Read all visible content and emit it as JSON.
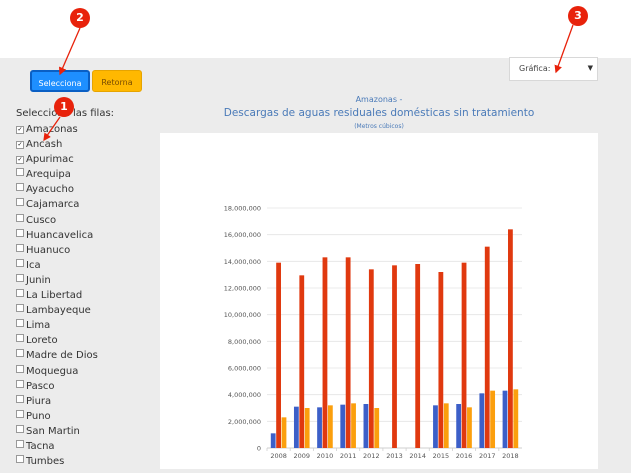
{
  "toolbar": {
    "select_label": "Selecciona",
    "return_label": "Retorna"
  },
  "chart_selector": {
    "label": "Gráfica:"
  },
  "rows": {
    "title": "Selecciona las filas:",
    "items": [
      {
        "label": "Amazonas",
        "checked": true
      },
      {
        "label": "Ancash",
        "checked": true
      },
      {
        "label": "Apurimac",
        "checked": true
      },
      {
        "label": "Arequipa",
        "checked": false
      },
      {
        "label": "Ayacucho",
        "checked": false
      },
      {
        "label": "Cajamarca",
        "checked": false
      },
      {
        "label": "Cusco",
        "checked": false
      },
      {
        "label": "Huancavelica",
        "checked": false
      },
      {
        "label": "Huanuco",
        "checked": false
      },
      {
        "label": "Ica",
        "checked": false
      },
      {
        "label": "Junin",
        "checked": false
      },
      {
        "label": "La Libertad",
        "checked": false
      },
      {
        "label": "Lambayeque",
        "checked": false
      },
      {
        "label": "Lima",
        "checked": false
      },
      {
        "label": "Loreto",
        "checked": false
      },
      {
        "label": "Madre de Dios",
        "checked": false
      },
      {
        "label": "Moquegua",
        "checked": false
      },
      {
        "label": "Pasco",
        "checked": false
      },
      {
        "label": "Piura",
        "checked": false
      },
      {
        "label": "Puno",
        "checked": false
      },
      {
        "label": "San Martin",
        "checked": false
      },
      {
        "label": "Tacna",
        "checked": false
      },
      {
        "label": "Tumbes",
        "checked": false
      }
    ]
  },
  "markers": [
    "1",
    "2",
    "3"
  ],
  "chart_data": {
    "type": "bar",
    "region_label": "Amazonas -",
    "title": "Descargas de aguas residuales domésticas sin tratamiento",
    "subtitle": "(Metros cúbicos)",
    "categories": [
      "2008",
      "2009",
      "2010",
      "2011",
      "2012",
      "2013",
      "2014",
      "2015",
      "2016",
      "2017",
      "2018"
    ],
    "series": [
      {
        "color": "#3c5fc8",
        "values": [
          1100000,
          3100000,
          3050000,
          3250000,
          3300000,
          null,
          null,
          3200000,
          3300000,
          4100000,
          4300000
        ]
      },
      {
        "color": "#e0390f",
        "values": [
          13900000,
          12950000,
          14300000,
          14300000,
          13400000,
          13700000,
          13800000,
          13200000,
          13900000,
          15100000,
          16400000
        ]
      },
      {
        "color": "#fb9f0d",
        "values": [
          2300000,
          3000000,
          3200000,
          3350000,
          3000000,
          null,
          null,
          3350000,
          3050000,
          4300000,
          4400000
        ]
      }
    ],
    "ylim": [
      0,
      18000000
    ],
    "yticks": [
      {
        "v": 0,
        "label": "0"
      },
      {
        "v": 2000000,
        "label": "2,000,000"
      },
      {
        "v": 4000000,
        "label": "4,000,000"
      },
      {
        "v": 6000000,
        "label": "6,000,000"
      },
      {
        "v": 8000000,
        "label": "8,000,000"
      },
      {
        "v": 10000000,
        "label": "10,000,000"
      },
      {
        "v": 12000000,
        "label": "12,000,000"
      },
      {
        "v": 14000000,
        "label": "14,000,000"
      },
      {
        "v": 16000000,
        "label": "16,000,000"
      },
      {
        "v": 18000000,
        "label": "18,000,000"
      }
    ]
  }
}
